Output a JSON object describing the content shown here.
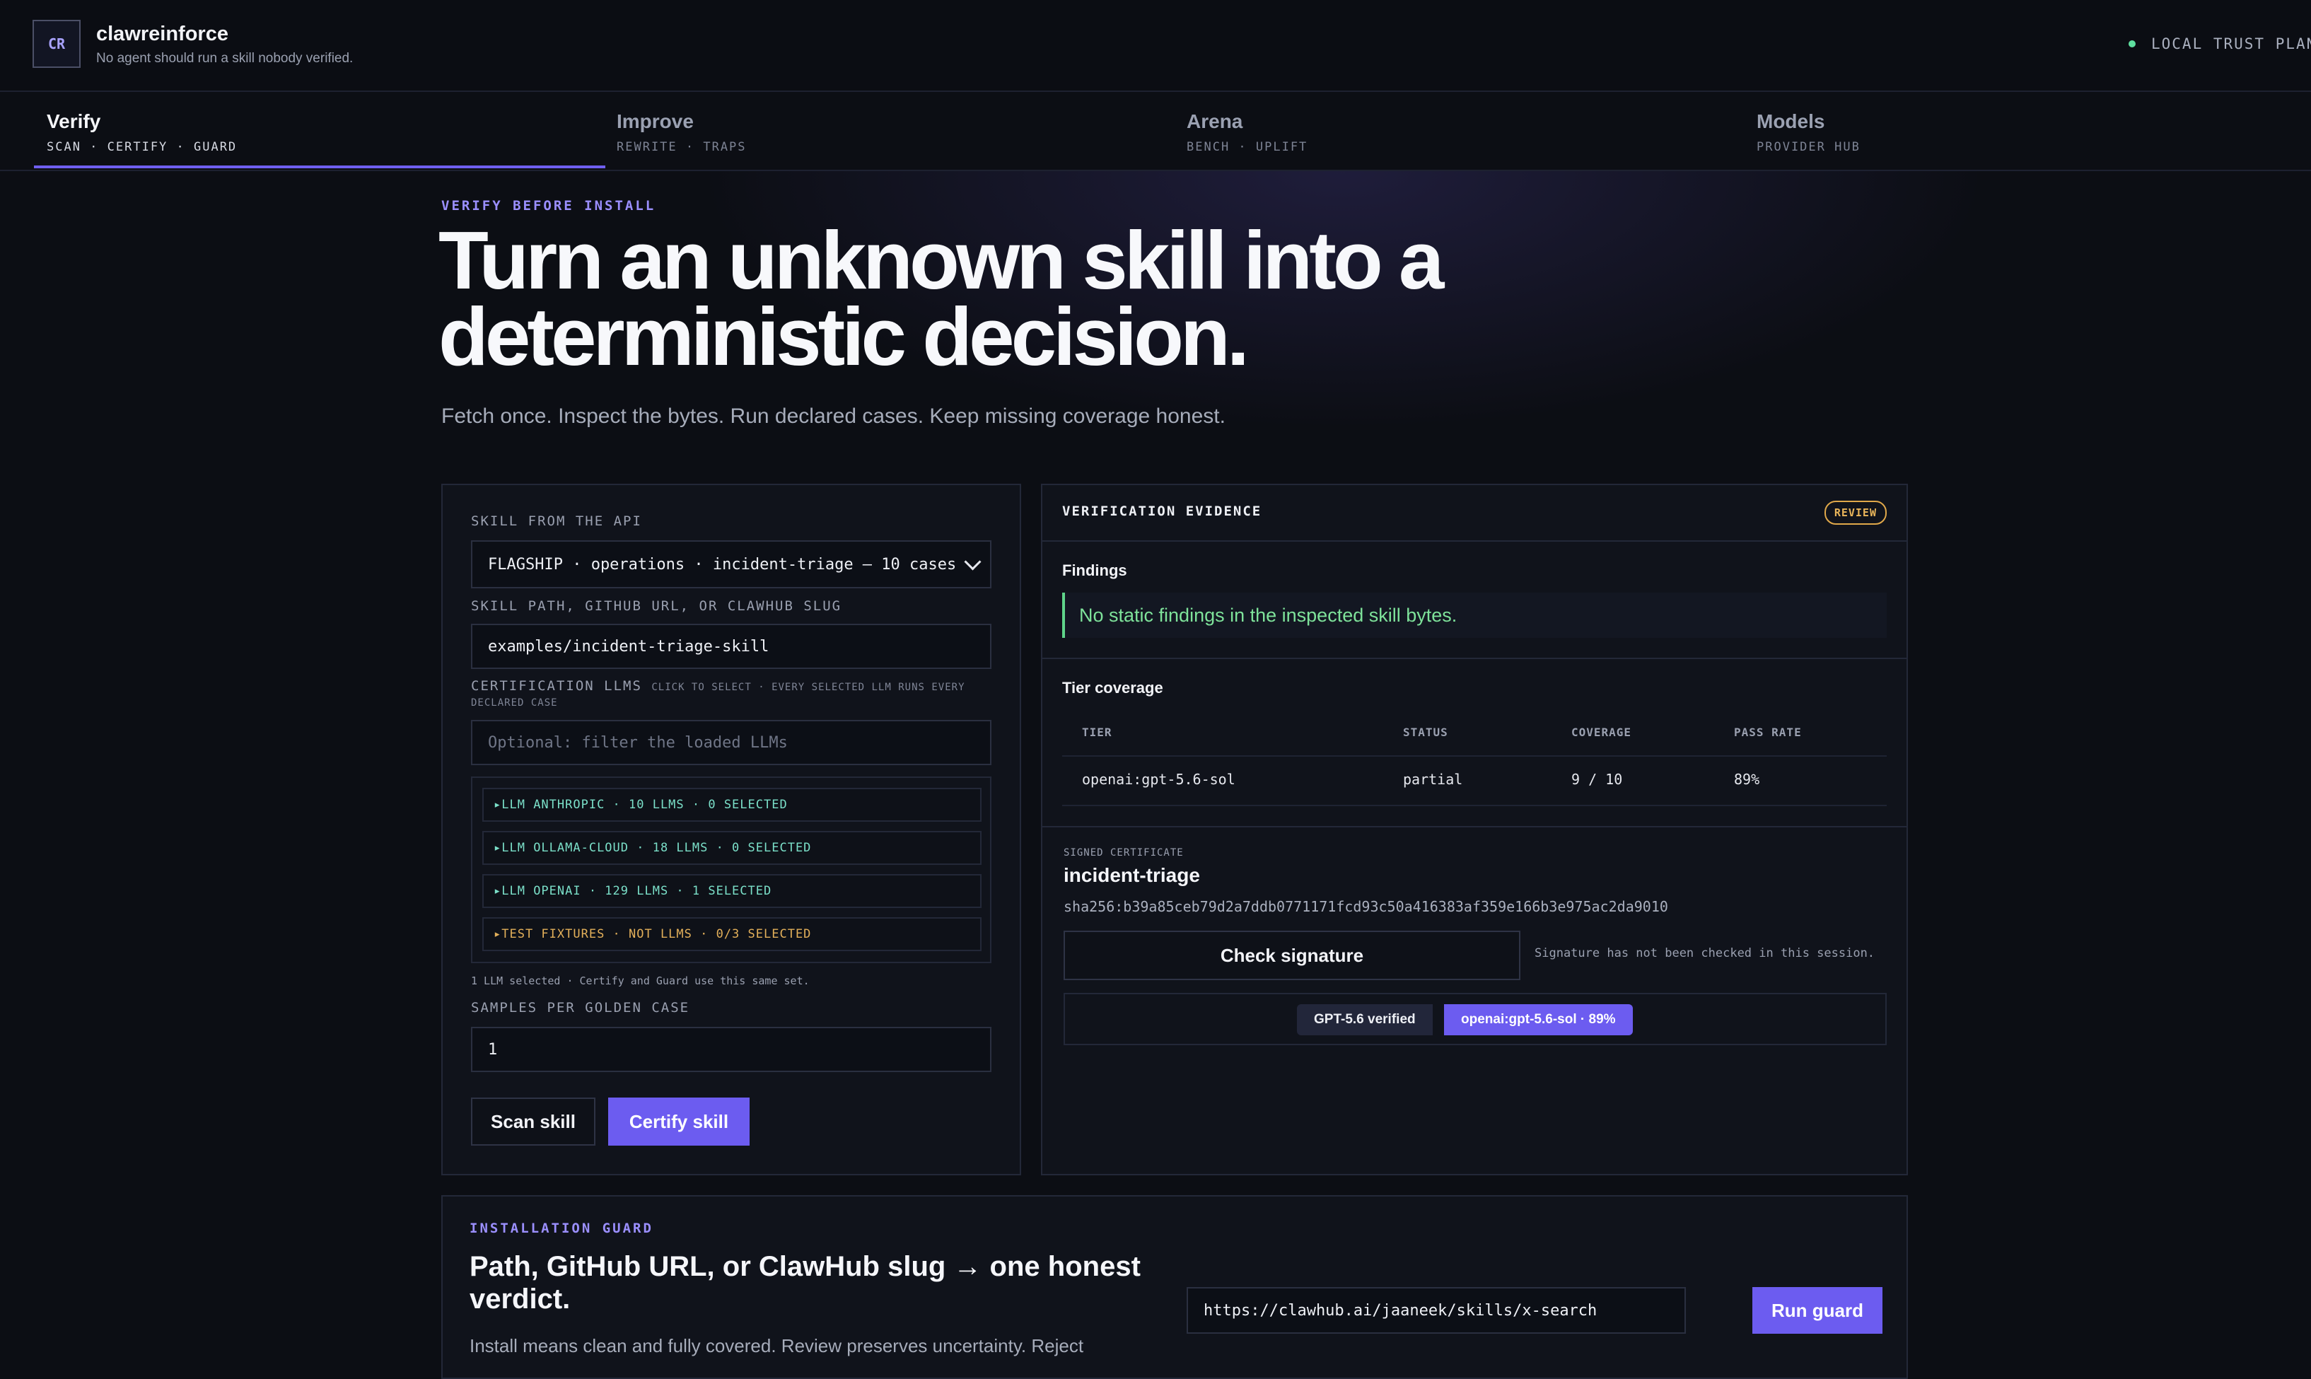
{
  "app": {
    "logo": "CR",
    "name": "clawreinforce",
    "tagline": "No agent should run a skill nobody verified.",
    "trust_label": "LOCAL TRUST PLANE",
    "trust_color": "#5fe0a0",
    "accent": "#6c5cf0"
  },
  "tabs": [
    {
      "label": "Verify",
      "sub": "SCAN · CERTIFY · GUARD",
      "active": true
    },
    {
      "label": "Improve",
      "sub": "REWRITE · TRAPS",
      "active": false
    },
    {
      "label": "Arena",
      "sub": "BENCH · UPLIFT",
      "active": false
    },
    {
      "label": "Models",
      "sub": "PROVIDER HUB",
      "active": false
    }
  ],
  "hero": {
    "eyebrow": "VERIFY BEFORE INSTALL",
    "title": "Turn an unknown skill into a deterministic decision.",
    "subtitle": "Fetch once. Inspect the bytes. Run declared cases. Keep missing coverage honest."
  },
  "form": {
    "skill_api_label": "SKILL FROM THE API",
    "skill_api_value": "FLAGSHIP · operations · incident-triage — 10 cases",
    "path_label": "SKILL PATH, GITHUB URL, OR CLAWHUB SLUG",
    "path_value": "examples/incident-triage-skill",
    "llms_label": "CERTIFICATION LLMS",
    "llms_hint": "CLICK TO SELECT · EVERY SELECTED LLM RUNS EVERY DECLARED CASE",
    "filter_placeholder": "Optional: filter the loaded LLMs",
    "groups": [
      {
        "label": "LLM ANTHROPIC · 10 LLMS · 0 SELECTED",
        "kind": "llm"
      },
      {
        "label": "LLM OLLAMA-CLOUD · 18 LLMS · 0 SELECTED",
        "kind": "llm"
      },
      {
        "label": "LLM OPENAI · 129 LLMS · 1 SELECTED",
        "kind": "llm"
      },
      {
        "label": "TEST FIXTURES · NOT LLMS · 0/3 SELECTED",
        "kind": "fixture"
      }
    ],
    "selection_note": "1 LLM selected · Certify and Guard use this same set.",
    "samples_label": "SAMPLES PER GOLDEN CASE",
    "samples_value": "1",
    "scan_button": "Scan skill",
    "certify_button": "Certify skill"
  },
  "evidence": {
    "title": "VERIFICATION EVIDENCE",
    "badge": "REVIEW",
    "badge_color": "#e0a84a",
    "findings_label": "Findings",
    "findings_text": "No static findings in the inspected skill bytes.",
    "tier_label": "Tier coverage",
    "table": {
      "headers": [
        "TIER",
        "STATUS",
        "COVERAGE",
        "PASS RATE"
      ],
      "rows": [
        [
          "openai:gpt-5.6-sol",
          "partial",
          "9 / 10",
          "89%"
        ]
      ]
    },
    "cert_label": "SIGNED CERTIFICATE",
    "cert_name": "incident-triage",
    "cert_hash": "sha256:b39a85ceb79d2a7ddb0771171fcd93c50a416383af359e166b3e975ac2da9010",
    "check_button": "Check signature",
    "check_note": "Signature has not been checked in this session.",
    "chip_verified": "GPT-5.6 verified",
    "chip_tier": "openai:gpt-5.6-sol · 89%"
  },
  "guard": {
    "eyebrow": "INSTALLATION GUARD",
    "title": "Path, GitHub URL, or ClawHub slug → one honest verdict.",
    "description": "Install means clean and fully covered. Review preserves uncertainty. Reject",
    "input_value": "https://clawhub.ai/jaaneek/skills/x-search",
    "run_button": "Run guard"
  }
}
